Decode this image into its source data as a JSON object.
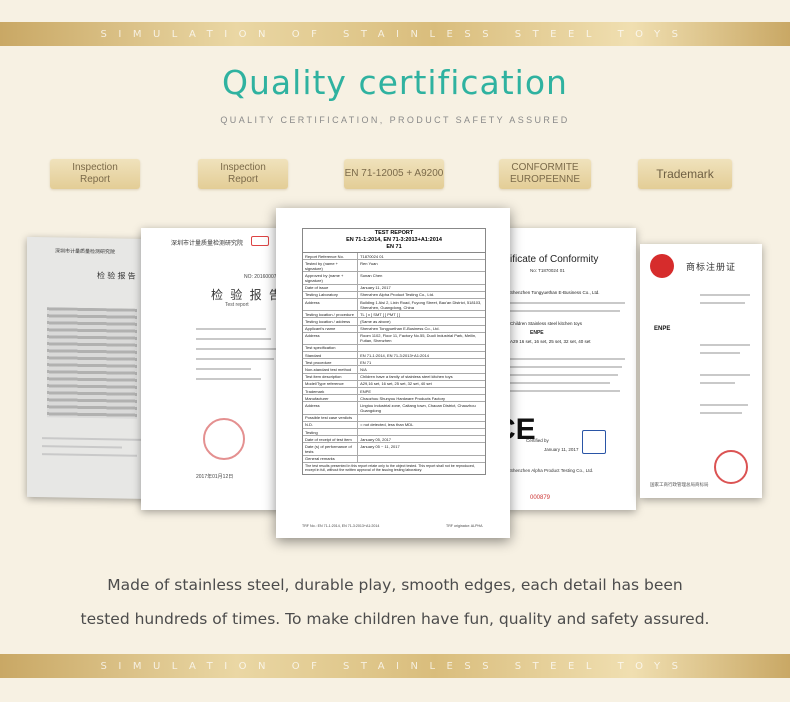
{
  "band_text": "SIMULATION OF STAINLESS STEEL TOYS",
  "title": "Quality certification",
  "subtitle": "QUALITY CERTIFICATION, PRODUCT SAFETY ASSURED",
  "tags": [
    {
      "line1": "Inspection",
      "line2": "Report"
    },
    {
      "line1": "Inspection",
      "line2": "Report"
    },
    {
      "line1": "EN 71-12005 + A9200",
      "line2": ""
    },
    {
      "line1": "CONFORMITE",
      "line2": "EUROPEENNE"
    },
    {
      "line1": "Trademark",
      "line2": ""
    }
  ],
  "report": {
    "heading": "TEST REPORT",
    "standard": "EN 71-1:2014, EN 71-3:2013+A1:2014",
    "sub": "EN 71",
    "rows": [
      [
        "Report Reference No.",
        "T1870024 01"
      ],
      [
        "Tested by (name + signature)",
        "Ren Yuan"
      ],
      [
        "Approved by (name + signature)",
        "Sunan Chen"
      ],
      [
        "Date of issue",
        "January 11, 2017"
      ],
      [
        "Testing Laboratory",
        "Shenzhen Alpha Product Testing Co., Ltd."
      ],
      [
        "Address",
        "Building 1 Aisi 2, Lixin Road, Fuyong Street, Bao'an District, 518103, Shenzhen, Guangdong, China"
      ],
      [
        "Testing location / procedure",
        "TL [ x ]   SMT [ ]   PMT [ ]"
      ],
      [
        "Testing location / address",
        "(Same as above)"
      ],
      [
        "Applicant's name",
        "Shenzhen Tongyuethan E-Business Co., Ltd."
      ],
      [
        "Address",
        "Room 1102, Floor 11, Factory No.55, Duoli Industrial Park, Meilin, Futian, Shenzhen"
      ],
      [
        "Test specification",
        ""
      ],
      [
        "Standard",
        "EN 71-1:2014, EN 71-3:2013+A1:2014"
      ],
      [
        "Test procedure",
        "EN 71"
      ],
      [
        "Non-standard test method",
        "N/A"
      ],
      [
        "Test item description",
        "Children have a family of stainless steel kitchen toys"
      ],
      [
        "Model/Type reference",
        "A29,16 set, 16 set, 25 set, 32 set, 40 set"
      ],
      [
        "Trademark",
        "ENPE"
      ],
      [
        "Manufacturer",
        "Chaozhou Shunyou Hardware Products Factory"
      ],
      [
        "Address",
        "Lingtou industrial zone, Caitang town, Chaoan District, Chaozhou Guangdong"
      ],
      [
        "Possible test case verdicts",
        ""
      ],
      [
        "N.D.",
        "= not detected, less than MDL"
      ],
      [
        "Testing",
        ""
      ],
      [
        "Date of receipt of test item",
        "January 05, 2017"
      ],
      [
        "Date (s) of performance of tests",
        "January 05 ~ 11, 2017"
      ],
      [
        "General remarks",
        ""
      ]
    ],
    "remark": "The test results presented in this report relate only to the object tested. This report shall not be reproduced, except in full, without the written approval of the issuing testing laboratory.",
    "footer_left": "TRF No.: EN 71-1:2014, EN 71-3:2013+A1:2014",
    "footer_right": "TRF originator: ALPHA"
  },
  "ce": {
    "title": "ificate of Conformity",
    "number": "No: T1870024 01",
    "company": "Shenzhen Tongyuethan E-Business Co., Ltd.",
    "product": "Children Stainless steel kitchen toys",
    "brand": "ENPE",
    "model": "A29 16 set, 16 set, 25 set, 32 set, 40 set",
    "certified": "Certified by",
    "date": "January 11, 2017",
    "lab": "Shenzhen Alpha Product Testing Co., Ltd.",
    "serial": "000879"
  },
  "inspection": {
    "org": "深圳市计量质量检测研究院",
    "title": "检 验 报 告",
    "subtitle": "Test report",
    "no": "NO: 2016000712357",
    "date": "2017年01月12日"
  },
  "trademark": {
    "title": "商标注册证",
    "brand": "ENPE",
    "authority": "国家工商行政管理总局商标局"
  },
  "caption_line1": "Made of stainless steel, durable play, smooth edges, each detail has been",
  "caption_line2": "tested hundreds of times. To make children have fun, quality and safety assured."
}
